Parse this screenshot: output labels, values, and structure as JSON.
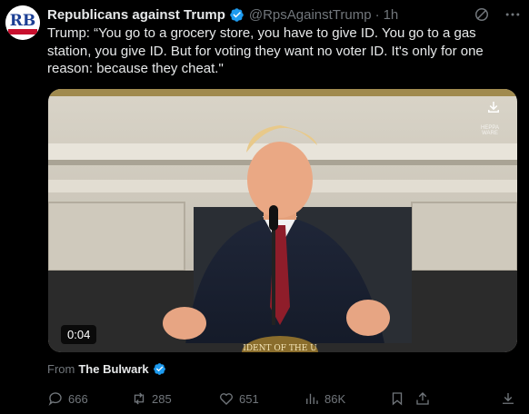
{
  "author": {
    "display_name": "Republicans against Trump",
    "handle": "@RpsAgainstTrump",
    "separator": "·",
    "timestamp": "1h",
    "avatar_text": "RB",
    "verified_color": "#1d9bf0"
  },
  "tweet": {
    "text": "Trump: “You go to a grocery store, you have to give ID. You go to a gas station, you give ID. But for voting they want no voter ID. It's only for one reason: because they cheat.\""
  },
  "video": {
    "duration": "0:04",
    "watermark": "HEPPA WARE",
    "podium_seal_text": "IDENT OF THE U"
  },
  "source": {
    "from_label": "From",
    "name": "The Bulwark"
  },
  "actions": {
    "replies": "666",
    "reposts": "285",
    "likes": "651",
    "views": "86K"
  },
  "icons": {
    "top": [
      "grok-icon",
      "more-icon"
    ],
    "actions": [
      "reply-icon",
      "repost-icon",
      "like-icon",
      "views-icon",
      "bookmark-icon",
      "share-icon",
      "download-icon"
    ]
  },
  "colors": {
    "background": "#000000",
    "primary_text": "#e7e9ea",
    "secondary_text": "#71767b",
    "accent": "#1d9bf0"
  }
}
